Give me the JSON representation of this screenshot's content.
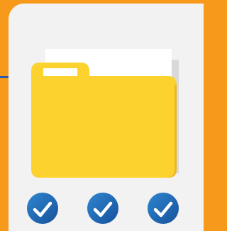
{
  "colors": {
    "background_orange": "#F79A1B",
    "card_gray": "#F2F2F2",
    "accent_blue": "#2B5BA8",
    "folder_yellow": "#FCD22E",
    "folder_shadow": "#F0B624",
    "paper_white": "#FFFFFF",
    "paper_gray": "#D9D9D9",
    "check_blue": "#1E6FB8",
    "check_white": "#FFFFFF"
  },
  "illustration": {
    "main_icon": "folder-icon",
    "status_icons": [
      "check-circle-icon",
      "check-circle-icon",
      "check-circle-icon"
    ]
  }
}
